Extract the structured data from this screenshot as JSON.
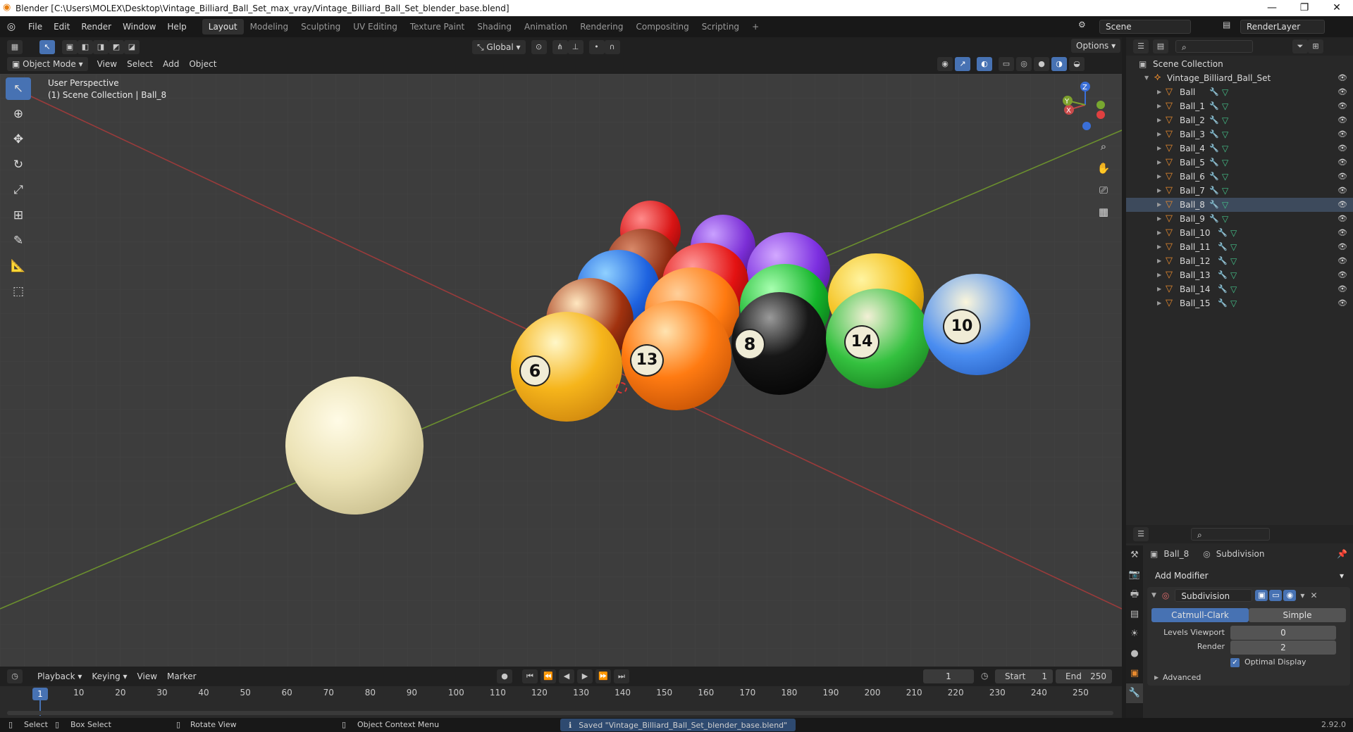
{
  "titlebar": {
    "title": "Blender [C:\\Users\\MOLEX\\Desktop\\Vintage_Billiard_Ball_Set_max_vray/Vintage_Billiard_Ball_Set_blender_base.blend]",
    "minimize": "—",
    "maximize": "❐",
    "close": "✕"
  },
  "menu": {
    "items": [
      "File",
      "Edit",
      "Render",
      "Window",
      "Help"
    ]
  },
  "workspaces": {
    "tabs": [
      "Layout",
      "Modeling",
      "Sculpting",
      "UV Editing",
      "Texture Paint",
      "Shading",
      "Animation",
      "Rendering",
      "Compositing",
      "Scripting"
    ],
    "active": "Layout",
    "add": "+"
  },
  "scene": {
    "scene_label": "Scene",
    "renderlayer_label": "RenderLayer"
  },
  "viewport_header": {
    "mode": "Object Mode",
    "menus": [
      "View",
      "Select",
      "Add",
      "Object"
    ],
    "orientation": "Global",
    "options": "Options"
  },
  "viewport": {
    "perspective": "User Perspective",
    "collection_info": "(1) Scene Collection | Ball_8",
    "axes": {
      "x": "X",
      "y": "Y",
      "z": "Z"
    }
  },
  "balls": {
    "numbers": [
      "8",
      "13",
      "14",
      "10",
      "6"
    ]
  },
  "outliner": {
    "root": "Scene Collection",
    "collection": "Vintage_Billiard_Ball_Set",
    "objects": [
      "Ball",
      "Ball_1",
      "Ball_2",
      "Ball_3",
      "Ball_4",
      "Ball_5",
      "Ball_6",
      "Ball_7",
      "Ball_8",
      "Ball_9",
      "Ball_10",
      "Ball_11",
      "Ball_12",
      "Ball_13",
      "Ball_14",
      "Ball_15"
    ],
    "selected": "Ball_8"
  },
  "properties": {
    "object_name": "Ball_8",
    "modifier_tab": "Subdivision",
    "add_modifier": "Add Modifier",
    "modifier_name": "Subdivision",
    "catmull": "Catmull-Clark",
    "simple": "Simple",
    "levels_viewport_label": "Levels Viewport",
    "levels_viewport_value": "0",
    "render_label": "Render",
    "render_value": "2",
    "optimal_display": "Optimal Display",
    "advanced": "Advanced"
  },
  "timeline": {
    "menus": [
      "Playback",
      "Keying",
      "View",
      "Marker"
    ],
    "current_frame": "1",
    "start_label": "Start",
    "start_value": "1",
    "end_label": "End",
    "end_value": "250",
    "ticks": [
      "1",
      "10",
      "20",
      "30",
      "40",
      "50",
      "60",
      "70",
      "80",
      "90",
      "100",
      "110",
      "120",
      "130",
      "140",
      "150",
      "160",
      "170",
      "180",
      "190",
      "200",
      "210",
      "220",
      "230",
      "240",
      "250"
    ]
  },
  "statusbar": {
    "select": "Select",
    "box_select": "Box Select",
    "rotate": "Rotate View",
    "context": "Object Context Menu",
    "saved": "Saved \"Vintage_Billiard_Ball_Set_blender_base.blend\"",
    "version": "2.92.0"
  },
  "colors": {
    "accent": "#4772b3",
    "selected_row": "#3d4a5c",
    "object_icon": "#e88a2e",
    "mesh_icon": "#44c28a"
  }
}
